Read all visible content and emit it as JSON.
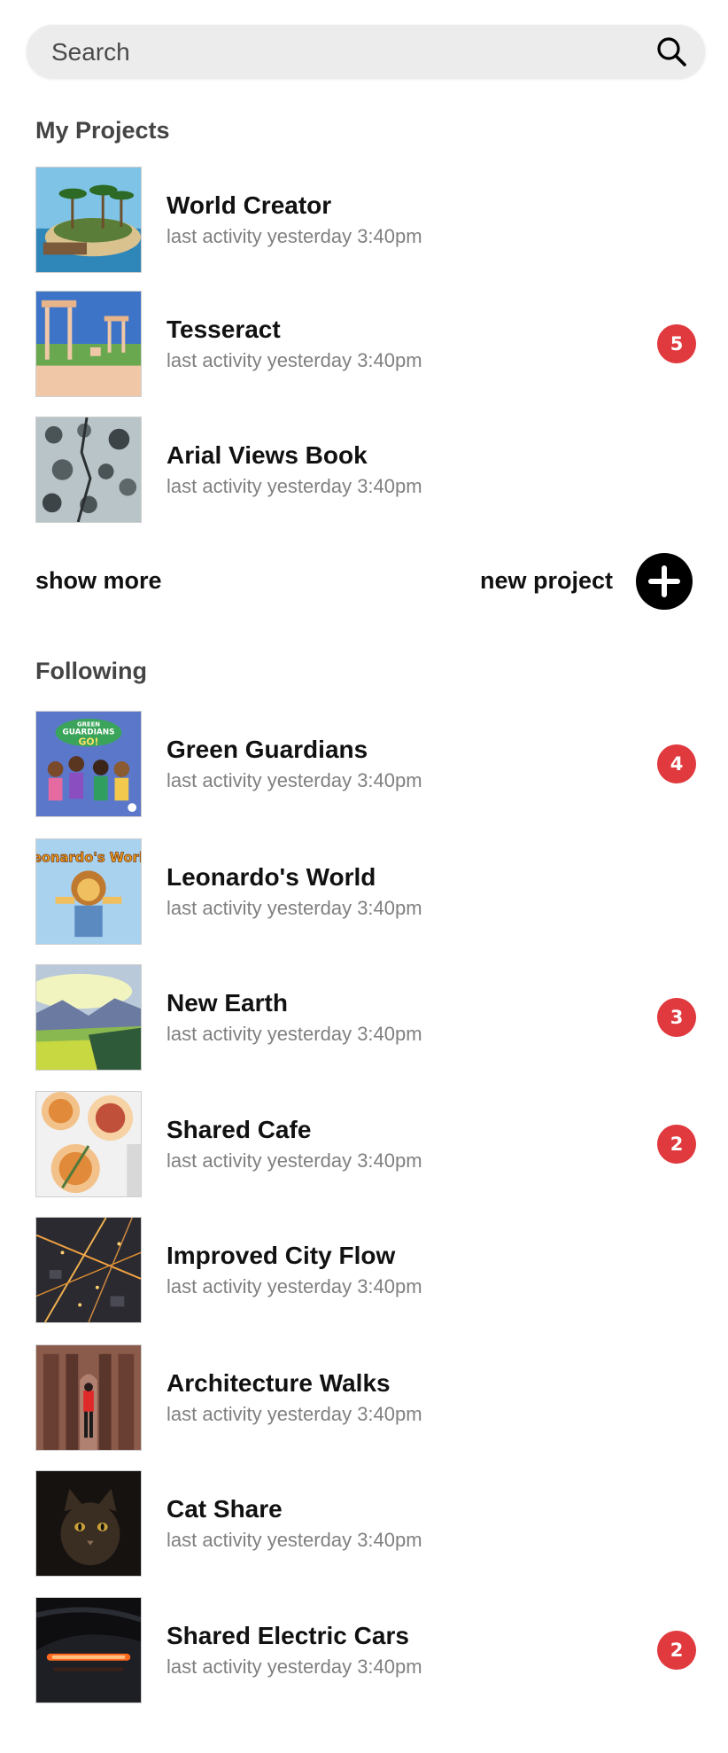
{
  "search": {
    "placeholder": "Search",
    "icon": "search-icon"
  },
  "my_projects": {
    "title": "My Projects",
    "items": [
      {
        "title": "World Creator",
        "subtitle": "last activity yesterday 3:40pm",
        "badge": null
      },
      {
        "title": "Tesseract",
        "subtitle": "last activity yesterday 3:40pm",
        "badge": "5"
      },
      {
        "title": "Arial Views Book",
        "subtitle": "last activity yesterday 3:40pm",
        "badge": null
      }
    ],
    "show_more_label": "show more",
    "new_project_label": "new project",
    "add_icon": "plus-icon"
  },
  "following": {
    "title": "Following",
    "items": [
      {
        "title": "Green Guardians",
        "subtitle": "last activity yesterday 3:40pm",
        "badge": "4",
        "thumb_text": [
          "GREEN",
          "GUARDIANS",
          "GO!"
        ]
      },
      {
        "title": "Leonardo's World",
        "subtitle": "last activity yesterday 3:40pm",
        "badge": null,
        "thumb_text": "Leonardo's World"
      },
      {
        "title": "New Earth",
        "subtitle": "last activity yesterday 3:40pm",
        "badge": "3"
      },
      {
        "title": "Shared Cafe",
        "subtitle": "last activity yesterday 3:40pm",
        "badge": "2"
      },
      {
        "title": "Improved City Flow",
        "subtitle": "last activity yesterday 3:40pm",
        "badge": null
      },
      {
        "title": "Architecture Walks",
        "subtitle": "last activity yesterday 3:40pm",
        "badge": null
      },
      {
        "title": "Cat Share",
        "subtitle": "last activity yesterday 3:40pm",
        "badge": null
      },
      {
        "title": "Shared Electric Cars",
        "subtitle": "last activity yesterday 3:40pm",
        "badge": "2"
      }
    ]
  },
  "colors": {
    "badge": "#e0393e",
    "search_bg": "#ececec",
    "subtitle": "#808080"
  }
}
